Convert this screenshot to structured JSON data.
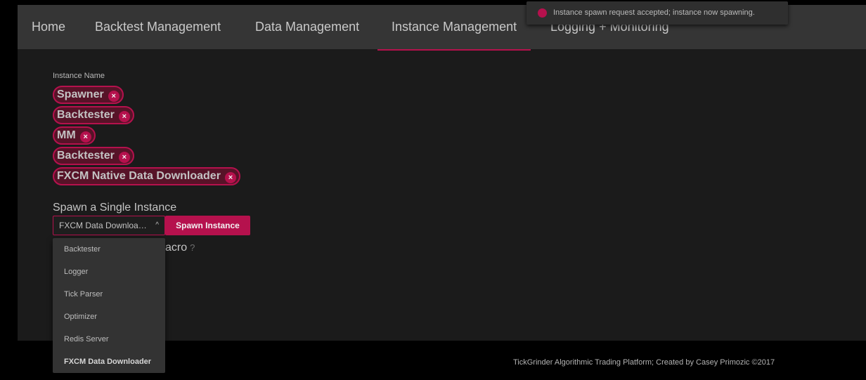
{
  "nav": {
    "items": [
      {
        "label": "Home"
      },
      {
        "label": "Backtest Management"
      },
      {
        "label": "Data Management"
      },
      {
        "label": "Instance Management",
        "active": true
      },
      {
        "label": "Logging + Monitoring"
      }
    ]
  },
  "toast": {
    "message": "Instance spawn request accepted; instance now spawning.",
    "icon": "alert-icon"
  },
  "instance_field": {
    "label": "Instance Name",
    "chips": [
      {
        "label": "Spawner"
      },
      {
        "label": "Backtester"
      },
      {
        "label": "MM"
      },
      {
        "label": "Backtester"
      },
      {
        "label": "FXCM Native Data Downloader"
      }
    ],
    "remove_glyph": "×"
  },
  "spawn_single": {
    "title": "Spawn a Single Instance",
    "selected_value": "FXCM Data Downloa…",
    "chevron": "^",
    "button_label": "Spawn Instance",
    "options": [
      {
        "label": "Backtester"
      },
      {
        "label": "Logger"
      },
      {
        "label": "Tick Parser"
      },
      {
        "label": "Optimizer"
      },
      {
        "label": "Redis Server"
      },
      {
        "label": "FXCM Data Downloader",
        "selected": true
      }
    ]
  },
  "macro_section": {
    "visible_text": "acro",
    "help_glyph": "?"
  },
  "footer": {
    "text": "TickGrinder Algorithmic Trading Platform; Created by Casey Primozic ©2017"
  },
  "colors": {
    "accent": "#b5114d",
    "navbar_bg": "#353535",
    "content_bg": "#1b1b1b"
  }
}
